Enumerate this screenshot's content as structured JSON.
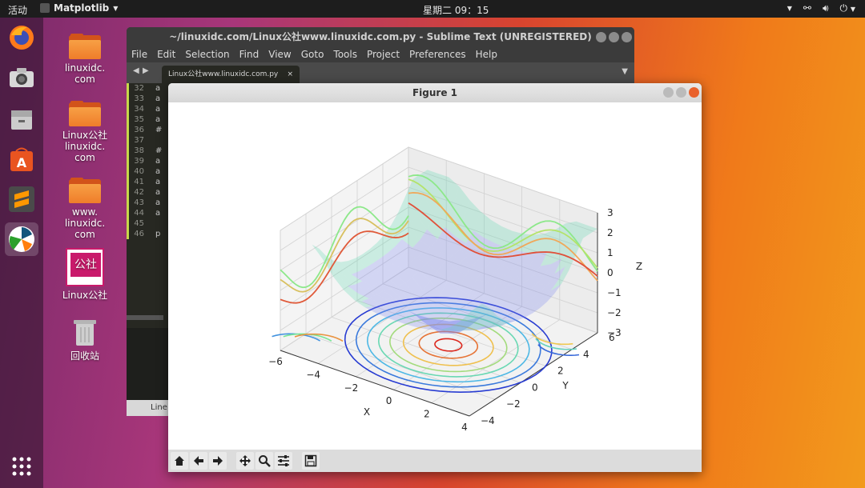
{
  "topbar": {
    "activities": "活动",
    "app_name": "Matplotlib",
    "clock": "星期二 09：15"
  },
  "dock": {
    "items": [
      "firefox-icon",
      "camera-icon",
      "files-icon",
      "software-icon",
      "sublime-text-icon",
      "matplotlib-icon",
      "apps-grid-icon"
    ]
  },
  "desktop": {
    "icons": [
      {
        "label": "linuxidc.\ncom"
      },
      {
        "label": "Linux公社\nlinuxidc.\ncom"
      },
      {
        "label": "www.\nlinuxidc.\ncom"
      },
      {
        "label": "Linux公社"
      },
      {
        "label": "回收站"
      }
    ],
    "logo_text": "公社"
  },
  "sublime": {
    "title": "~/linuxidc.com/Linux公社www.linuxidc.com.py - Sublime Text (UNREGISTERED)",
    "menu": [
      "File",
      "Edit",
      "Selection",
      "Find",
      "View",
      "Goto",
      "Tools",
      "Project",
      "Preferences",
      "Help"
    ],
    "tab": "Linux公社www.linuxidc.com.py",
    "tab_close": "×",
    "lines": [
      {
        "n": "32",
        "t": "a"
      },
      {
        "n": "33",
        "t": "a"
      },
      {
        "n": "34",
        "t": "a"
      },
      {
        "n": "35",
        "t": "a"
      },
      {
        "n": "36",
        "t": "#"
      },
      {
        "n": "37",
        "t": ""
      },
      {
        "n": "38",
        "t": "#"
      },
      {
        "n": "39",
        "t": "a"
      },
      {
        "n": "40",
        "t": "a"
      },
      {
        "n": "41",
        "t": "a"
      },
      {
        "n": "42",
        "t": "a"
      },
      {
        "n": "43",
        "t": "a"
      },
      {
        "n": "44",
        "t": "a"
      },
      {
        "n": "45",
        "t": ""
      },
      {
        "n": "46",
        "t": "p"
      }
    ],
    "status": "Line"
  },
  "figure": {
    "title": "Figure 1",
    "toolbar": [
      "home-icon",
      "back-arrow-icon",
      "forward-arrow-icon",
      "pan-icon",
      "zoom-icon",
      "configure-icon",
      "save-icon"
    ]
  },
  "chart_data": {
    "type": "surface3d",
    "title": "",
    "xlabel": "X",
    "ylabel": "Y",
    "zlabel": "Z",
    "xlim": [
      -6,
      4
    ],
    "ylim": [
      -4,
      6
    ],
    "zlim": [
      -3,
      3
    ],
    "x_ticks": [
      "−6",
      "−4",
      "−2",
      "0",
      "2",
      "4"
    ],
    "y_ticks": [
      "−4",
      "−2",
      "0",
      "2",
      "4",
      "6"
    ],
    "z_ticks": [
      "−3",
      "−2",
      "−1",
      "0",
      "1",
      "2",
      "3"
    ],
    "grid": true,
    "surface_color": "#7b86f0",
    "contour_projections": [
      "z",
      "x",
      "y"
    ],
    "colormap": "coolwarm/rainbow"
  }
}
